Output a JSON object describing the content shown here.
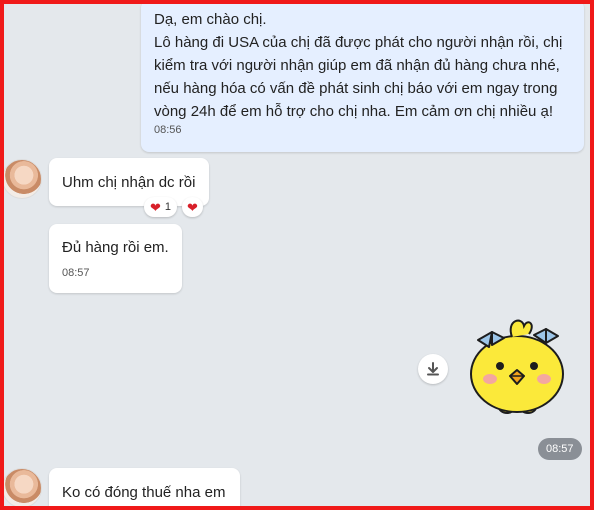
{
  "messages": {
    "outgoing1": {
      "lines": [
        "Dạ, em chào chị.",
        "Lô hàng đi USA của chị đã được phát cho người nhận rồi, chị",
        "kiểm tra với người nhận giúp em đã nhận đủ hàng chưa nhé,",
        "nếu hàng hóa có vấn đề phát sinh chị báo với em ngay trong",
        "vòng 24h để em hỗ trợ cho chị nha. Em cảm ơn chị nhiều ạ!"
      ],
      "time": "08:56"
    },
    "incoming1": {
      "text": "Uhm chị nhận dc rồi",
      "reaction_count": "1"
    },
    "incoming2": {
      "text": "Đủ hàng rồi em.",
      "time": "08:57"
    },
    "sticker": {
      "time": "08:57"
    },
    "incoming3": {
      "text": "Ko có đóng thuế nha em"
    }
  },
  "colors": {
    "frame_border": "#f01919",
    "chat_background": "#e4e8ec",
    "outgoing_bubble": "#e5efff",
    "incoming_bubble": "#ffffff",
    "reaction_heart": "#d8202a"
  },
  "icons": {
    "download": "download-icon",
    "heart": "heart-icon"
  }
}
